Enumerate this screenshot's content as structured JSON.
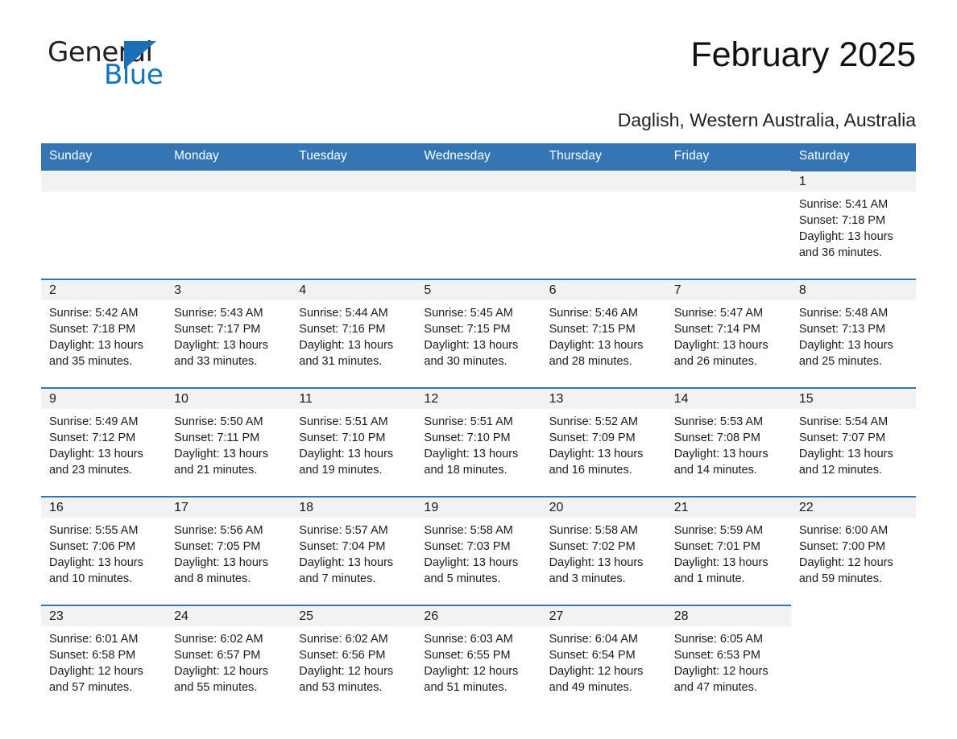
{
  "logo": {
    "word1": "General",
    "word2": "Blue",
    "triangle_color": "#1b6fb5",
    "blue_text_color": "#0f75bd"
  },
  "header": {
    "month_title": "February 2025",
    "location": "Daglish, Western Australia, Australia"
  },
  "theme": {
    "header_blue": "#3575b4",
    "day_band_gray": "#f2f2f2",
    "text_color": "#1a1a1a"
  },
  "weekday_headers": [
    "Sunday",
    "Monday",
    "Tuesday",
    "Wednesday",
    "Thursday",
    "Friday",
    "Saturday"
  ],
  "weeks": [
    [
      {
        "day": "",
        "lines": []
      },
      {
        "day": "",
        "lines": []
      },
      {
        "day": "",
        "lines": []
      },
      {
        "day": "",
        "lines": []
      },
      {
        "day": "",
        "lines": []
      },
      {
        "day": "",
        "lines": []
      },
      {
        "day": "1",
        "lines": [
          "Sunrise: 5:41 AM",
          "Sunset: 7:18 PM",
          "Daylight: 13 hours",
          "and 36 minutes."
        ]
      }
    ],
    [
      {
        "day": "2",
        "lines": [
          "Sunrise: 5:42 AM",
          "Sunset: 7:18 PM",
          "Daylight: 13 hours",
          "and 35 minutes."
        ]
      },
      {
        "day": "3",
        "lines": [
          "Sunrise: 5:43 AM",
          "Sunset: 7:17 PM",
          "Daylight: 13 hours",
          "and 33 minutes."
        ]
      },
      {
        "day": "4",
        "lines": [
          "Sunrise: 5:44 AM",
          "Sunset: 7:16 PM",
          "Daylight: 13 hours",
          "and 31 minutes."
        ]
      },
      {
        "day": "5",
        "lines": [
          "Sunrise: 5:45 AM",
          "Sunset: 7:15 PM",
          "Daylight: 13 hours",
          "and 30 minutes."
        ]
      },
      {
        "day": "6",
        "lines": [
          "Sunrise: 5:46 AM",
          "Sunset: 7:15 PM",
          "Daylight: 13 hours",
          "and 28 minutes."
        ]
      },
      {
        "day": "7",
        "lines": [
          "Sunrise: 5:47 AM",
          "Sunset: 7:14 PM",
          "Daylight: 13 hours",
          "and 26 minutes."
        ]
      },
      {
        "day": "8",
        "lines": [
          "Sunrise: 5:48 AM",
          "Sunset: 7:13 PM",
          "Daylight: 13 hours",
          "and 25 minutes."
        ]
      }
    ],
    [
      {
        "day": "9",
        "lines": [
          "Sunrise: 5:49 AM",
          "Sunset: 7:12 PM",
          "Daylight: 13 hours",
          "and 23 minutes."
        ]
      },
      {
        "day": "10",
        "lines": [
          "Sunrise: 5:50 AM",
          "Sunset: 7:11 PM",
          "Daylight: 13 hours",
          "and 21 minutes."
        ]
      },
      {
        "day": "11",
        "lines": [
          "Sunrise: 5:51 AM",
          "Sunset: 7:10 PM",
          "Daylight: 13 hours",
          "and 19 minutes."
        ]
      },
      {
        "day": "12",
        "lines": [
          "Sunrise: 5:51 AM",
          "Sunset: 7:10 PM",
          "Daylight: 13 hours",
          "and 18 minutes."
        ]
      },
      {
        "day": "13",
        "lines": [
          "Sunrise: 5:52 AM",
          "Sunset: 7:09 PM",
          "Daylight: 13 hours",
          "and 16 minutes."
        ]
      },
      {
        "day": "14",
        "lines": [
          "Sunrise: 5:53 AM",
          "Sunset: 7:08 PM",
          "Daylight: 13 hours",
          "and 14 minutes."
        ]
      },
      {
        "day": "15",
        "lines": [
          "Sunrise: 5:54 AM",
          "Sunset: 7:07 PM",
          "Daylight: 13 hours",
          "and 12 minutes."
        ]
      }
    ],
    [
      {
        "day": "16",
        "lines": [
          "Sunrise: 5:55 AM",
          "Sunset: 7:06 PM",
          "Daylight: 13 hours",
          "and 10 minutes."
        ]
      },
      {
        "day": "17",
        "lines": [
          "Sunrise: 5:56 AM",
          "Sunset: 7:05 PM",
          "Daylight: 13 hours",
          "and 8 minutes."
        ]
      },
      {
        "day": "18",
        "lines": [
          "Sunrise: 5:57 AM",
          "Sunset: 7:04 PM",
          "Daylight: 13 hours",
          "and 7 minutes."
        ]
      },
      {
        "day": "19",
        "lines": [
          "Sunrise: 5:58 AM",
          "Sunset: 7:03 PM",
          "Daylight: 13 hours",
          "and 5 minutes."
        ]
      },
      {
        "day": "20",
        "lines": [
          "Sunrise: 5:58 AM",
          "Sunset: 7:02 PM",
          "Daylight: 13 hours",
          "and 3 minutes."
        ]
      },
      {
        "day": "21",
        "lines": [
          "Sunrise: 5:59 AM",
          "Sunset: 7:01 PM",
          "Daylight: 13 hours",
          "and 1 minute."
        ]
      },
      {
        "day": "22",
        "lines": [
          "Sunrise: 6:00 AM",
          "Sunset: 7:00 PM",
          "Daylight: 12 hours",
          "and 59 minutes."
        ]
      }
    ],
    [
      {
        "day": "23",
        "lines": [
          "Sunrise: 6:01 AM",
          "Sunset: 6:58 PM",
          "Daylight: 12 hours",
          "and 57 minutes."
        ]
      },
      {
        "day": "24",
        "lines": [
          "Sunrise: 6:02 AM",
          "Sunset: 6:57 PM",
          "Daylight: 12 hours",
          "and 55 minutes."
        ]
      },
      {
        "day": "25",
        "lines": [
          "Sunrise: 6:02 AM",
          "Sunset: 6:56 PM",
          "Daylight: 12 hours",
          "and 53 minutes."
        ]
      },
      {
        "day": "26",
        "lines": [
          "Sunrise: 6:03 AM",
          "Sunset: 6:55 PM",
          "Daylight: 12 hours",
          "and 51 minutes."
        ]
      },
      {
        "day": "27",
        "lines": [
          "Sunrise: 6:04 AM",
          "Sunset: 6:54 PM",
          "Daylight: 12 hours",
          "and 49 minutes."
        ]
      },
      {
        "day": "28",
        "lines": [
          "Sunrise: 6:05 AM",
          "Sunset: 6:53 PM",
          "Daylight: 12 hours",
          "and 47 minutes."
        ]
      },
      {
        "day": "",
        "lines": []
      }
    ]
  ]
}
